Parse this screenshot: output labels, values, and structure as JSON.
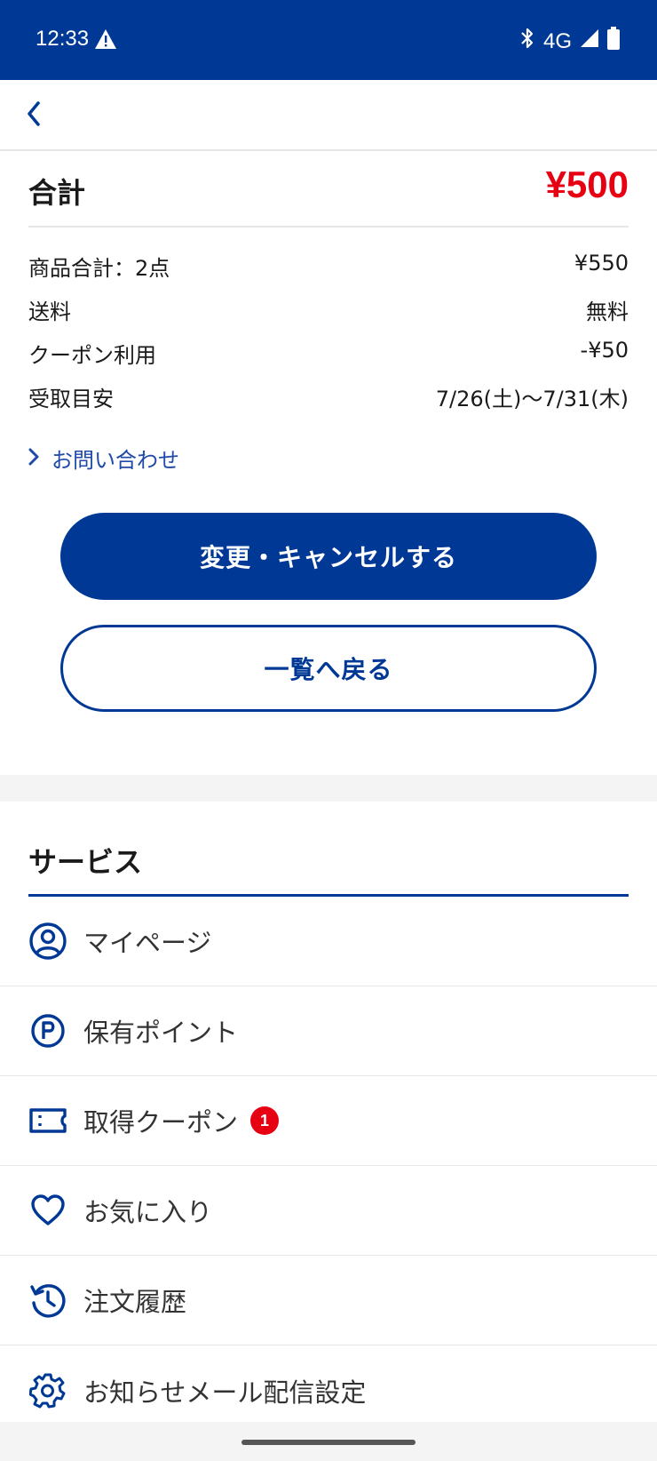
{
  "status_bar": {
    "time": "12:33",
    "network": "4G",
    "icons": [
      "warning-icon",
      "bluetooth-icon",
      "signal-icon",
      "battery-icon"
    ],
    "background": "#003896"
  },
  "header": {
    "back_icon": "chevron-left-icon"
  },
  "summary": {
    "total_label": "合計",
    "total_value": "¥500",
    "rows": [
      {
        "label": "商品合計：2点",
        "value": "¥550"
      },
      {
        "label": "送料",
        "value": "無料"
      },
      {
        "label": "クーポン利用",
        "value": "-¥50"
      },
      {
        "label": "受取目安",
        "value": "7/26(土)〜7/31(木)"
      }
    ]
  },
  "inquiry": {
    "label": "お問い合わせ"
  },
  "actions": {
    "change_cancel": "変更・キャンセルする",
    "back_to_list": "一覧へ戻る"
  },
  "services": {
    "title": "サービス",
    "items": [
      {
        "label": "マイページ",
        "icon": "user-circle-icon"
      },
      {
        "label": "保有ポイント",
        "icon": "point-icon"
      },
      {
        "label": "取得クーポン",
        "icon": "coupon-icon",
        "badge": "1"
      },
      {
        "label": "お気に入り",
        "icon": "heart-icon"
      },
      {
        "label": "注文履歴",
        "icon": "history-icon"
      },
      {
        "label": "お知らせメール配信設定",
        "icon": "gear-icon"
      }
    ]
  },
  "colors": {
    "brand": "#003896",
    "price_red": "#e60012",
    "link": "#1f4aa8"
  }
}
